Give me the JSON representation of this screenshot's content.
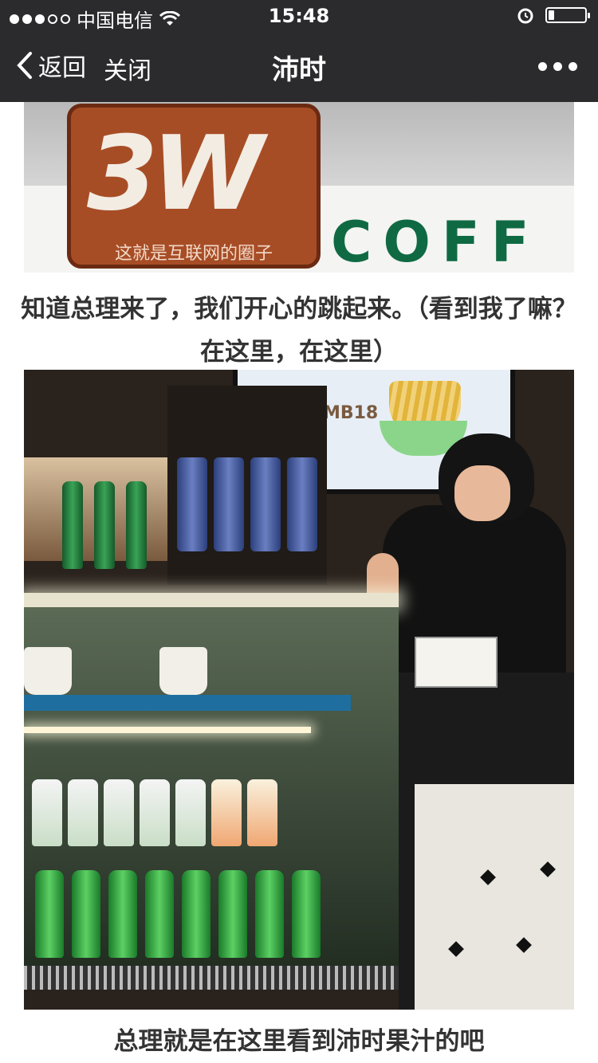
{
  "status_bar": {
    "carrier": "中国电信",
    "time": "15:48",
    "signal_filled": 3,
    "signal_total": 5,
    "battery_level": 0.15
  },
  "nav": {
    "back_label": "返回",
    "close_label": "关闭",
    "title": "沛时"
  },
  "article": {
    "sign_text": "3W",
    "sign_slogan": "这就是互联网的圈子",
    "sign_coffee": "COFF",
    "caption1": "知道总理来了，我们开心的跳起来。（看到我了嘛？在这里，在这里）",
    "menu_price": "RMB18",
    "caption2": "总理就是在这里看到沛时果汁的吧"
  },
  "icons": {
    "back": "chevron-left-icon",
    "wifi": "wifi-icon",
    "alarm": "alarm-icon",
    "battery": "battery-icon",
    "more": "more-dots-icon"
  },
  "colors": {
    "bar_bg": "#2b2b2d",
    "text_white": "#ffffff",
    "caption_text": "#333333",
    "coffee_green": "#0f6a43",
    "logo_brown": "#a74d26"
  }
}
